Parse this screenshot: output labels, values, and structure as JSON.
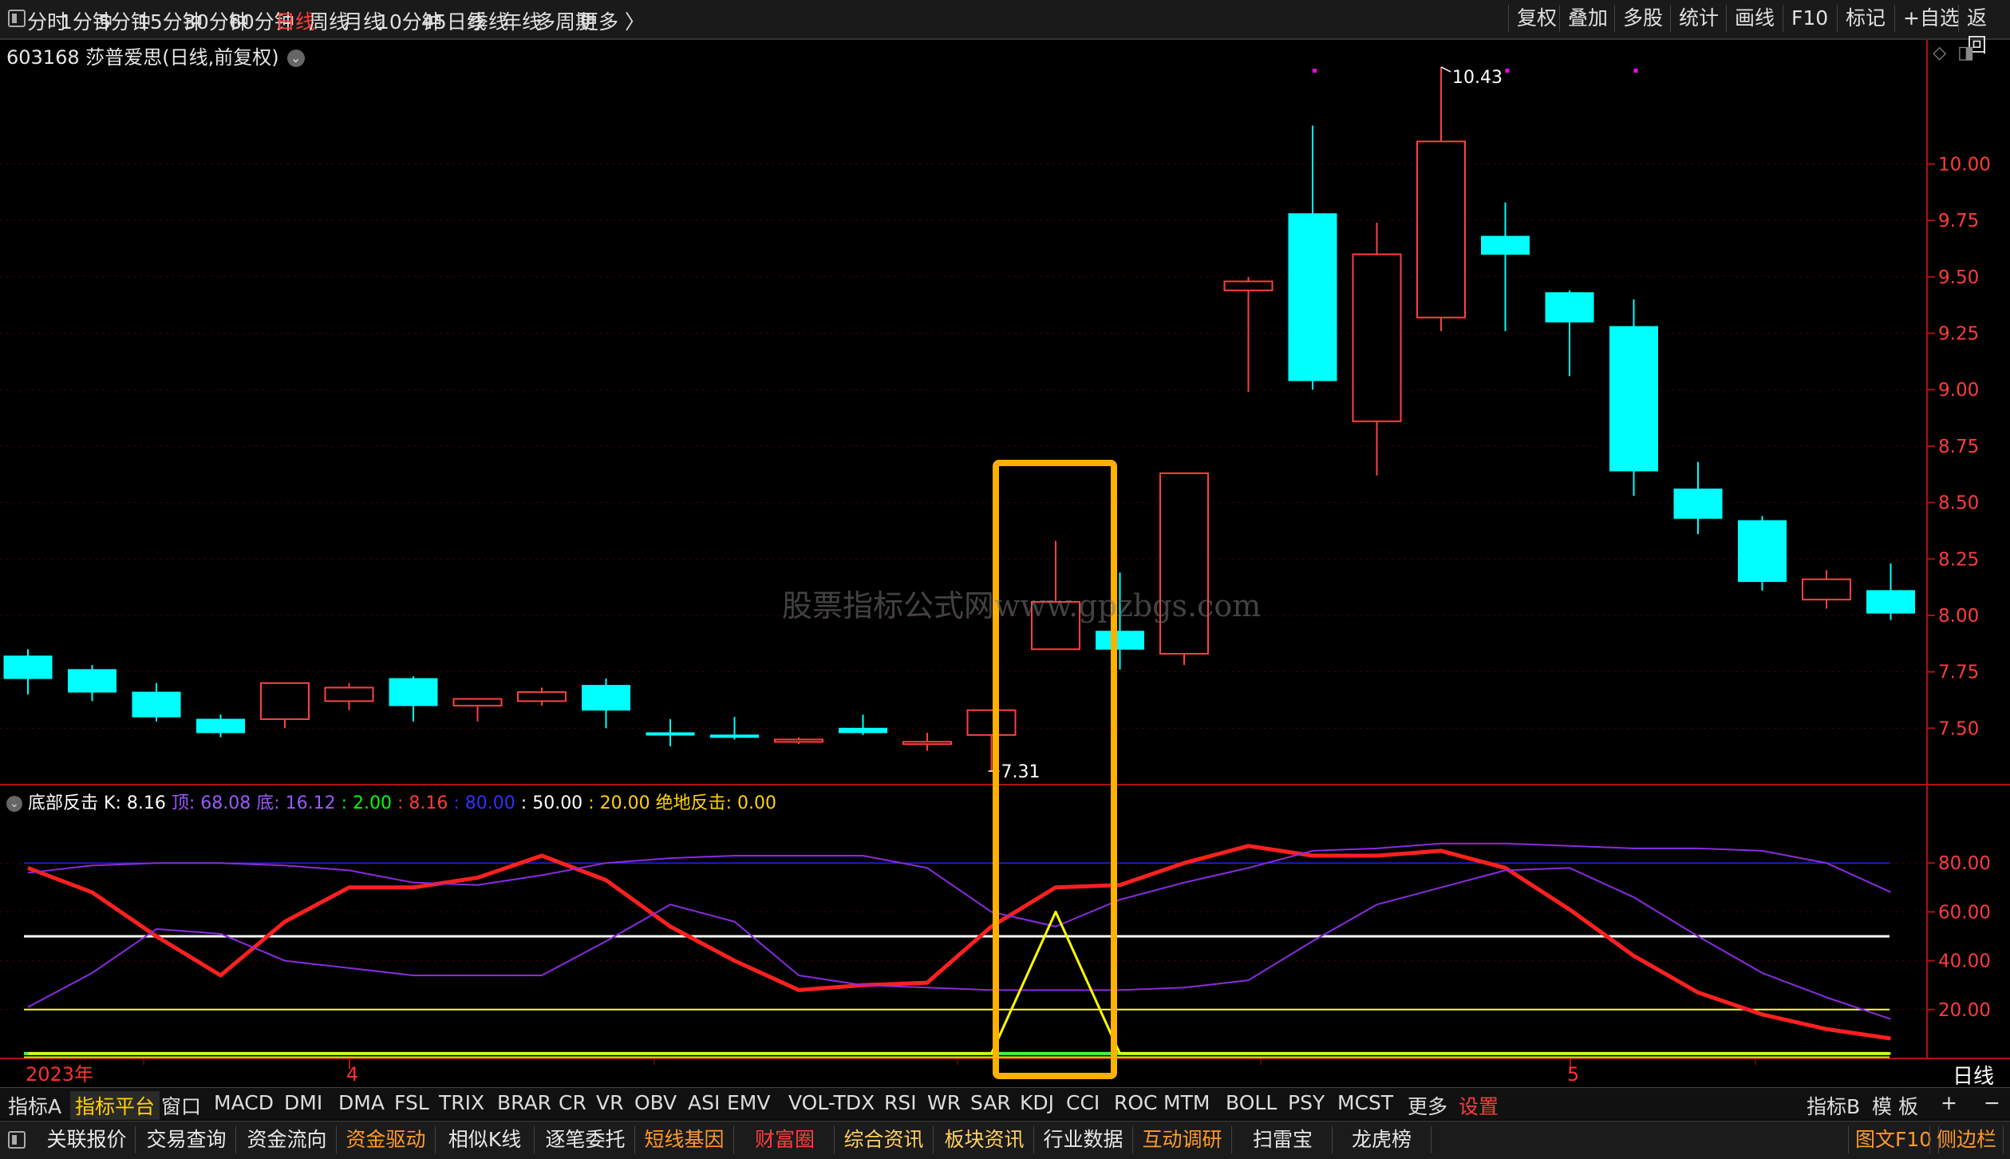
{
  "toolbar": {
    "periods": [
      "分时",
      "1分钟",
      "5分钟",
      "15分钟",
      "30分钟",
      "60分钟",
      "日线",
      "周线",
      "月线",
      "10分钟",
      "45日线",
      "季线",
      "年线",
      "多周期",
      "更多 〉"
    ],
    "active_period": "日线",
    "right_items": [
      "复权",
      "叠加",
      "多股",
      "统计",
      "画线",
      "F10",
      "标记",
      "+自选",
      "返回"
    ]
  },
  "stock": {
    "title": "603168 莎普爱思(日线,前复权)",
    "period_label": "日线",
    "high_label": "10.43",
    "low_label": "7.31"
  },
  "watermark": "股票指标公式网www.gpzbgs.com",
  "indicator": {
    "name": "底部反击",
    "k": "K: 8.16",
    "top": "顶: 68.08",
    "bottom": "底: 16.12",
    "v1": ": 2.00",
    "v2": ": 8.16",
    "v3": ": 80.00",
    "v4": ": 50.00",
    "v5": ": 20.00",
    "v6": "绝地反击: 0.00",
    "colors": {
      "k": "#ffffff",
      "top": "#9b59ff",
      "bottom": "#9b59ff",
      "v1": "#00ff00",
      "v2": "#ff3c3c",
      "v3": "#2020ff",
      "v4": "#ffffff",
      "v5": "#ffd400",
      "v6": "#ffd400"
    }
  },
  "date_axis": {
    "year": "2023年",
    "m4": "4",
    "m5": "5"
  },
  "indicator_tabs": [
    "指标A",
    "指标平台",
    "窗口",
    "MACD",
    "DMI",
    "DMA",
    "FSL",
    "TRIX",
    "BRAR",
    "CR",
    "VR",
    "OBV",
    "ASI",
    "EMV",
    "VOL-TDX",
    "RSI",
    "WR",
    "SAR",
    "KDJ",
    "CCI",
    "ROC",
    "MTM",
    "BOLL",
    "PSY",
    "MCST",
    "更多",
    "设置"
  ],
  "indicator_right": [
    "指标B",
    "模 板",
    "+",
    "−"
  ],
  "bottom_tabs": [
    "关联报价",
    "交易查询",
    "资金流向",
    "资金驱动",
    "相似K线",
    "逐笔委托",
    "短线基因",
    "财富圈",
    "综合资讯",
    "板块资讯",
    "行业数据",
    "互动调研",
    "扫雷宝",
    "龙虎榜"
  ],
  "bottom_right": [
    "图文F10",
    "侧边栏"
  ],
  "chart_data": [
    {
      "type": "candlestick",
      "price_axis": [
        10.0,
        9.75,
        9.5,
        9.25,
        9.0,
        8.75,
        8.5,
        8.25,
        8.0,
        7.75,
        7.5
      ],
      "ylim": [
        7.25,
        10.55
      ],
      "candles": [
        {
          "o": 7.82,
          "h": 7.85,
          "l": 7.65,
          "c": 7.72,
          "up": false
        },
        {
          "o": 7.76,
          "h": 7.78,
          "l": 7.62,
          "c": 7.66,
          "up": false
        },
        {
          "o": 7.66,
          "h": 7.7,
          "l": 7.53,
          "c": 7.55,
          "up": false
        },
        {
          "o": 7.54,
          "h": 7.56,
          "l": 7.46,
          "c": 7.48,
          "up": false
        },
        {
          "o": 7.54,
          "h": 7.7,
          "l": 7.5,
          "c": 7.7,
          "up": true
        },
        {
          "o": 7.62,
          "h": 7.7,
          "l": 7.58,
          "c": 7.68,
          "up": true
        },
        {
          "o": 7.72,
          "h": 7.73,
          "l": 7.53,
          "c": 7.6,
          "up": false
        },
        {
          "o": 7.6,
          "h": 7.63,
          "l": 7.53,
          "c": 7.63,
          "up": true
        },
        {
          "o": 7.62,
          "h": 7.68,
          "l": 7.6,
          "c": 7.66,
          "up": true
        },
        {
          "o": 7.69,
          "h": 7.72,
          "l": 7.5,
          "c": 7.58,
          "up": false
        },
        {
          "o": 7.48,
          "h": 7.54,
          "l": 7.42,
          "c": 7.47,
          "up": false
        },
        {
          "o": 7.47,
          "h": 7.55,
          "l": 7.45,
          "c": 7.46,
          "up": false
        },
        {
          "o": 7.44,
          "h": 7.46,
          "l": 7.43,
          "c": 7.45,
          "up": true
        },
        {
          "o": 7.5,
          "h": 7.56,
          "l": 7.47,
          "c": 7.48,
          "up": false
        },
        {
          "o": 7.43,
          "h": 7.48,
          "l": 7.4,
          "c": 7.44,
          "up": true
        },
        {
          "o": 7.47,
          "h": 7.51,
          "l": 7.31,
          "c": 7.58,
          "up": true
        },
        {
          "o": 7.85,
          "h": 8.33,
          "l": 7.85,
          "c": 8.06,
          "up": true
        },
        {
          "o": 7.93,
          "h": 8.19,
          "l": 7.76,
          "c": 7.85,
          "up": false
        },
        {
          "o": 7.83,
          "h": 8.63,
          "l": 7.78,
          "c": 8.63,
          "up": true
        },
        {
          "o": 9.44,
          "h": 9.5,
          "l": 8.99,
          "c": 9.48,
          "up": true
        },
        {
          "o": 9.78,
          "h": 10.17,
          "l": 9.0,
          "c": 9.04,
          "up": false
        },
        {
          "o": 8.86,
          "h": 9.74,
          "l": 8.62,
          "c": 9.6,
          "up": true
        },
        {
          "o": 9.32,
          "h": 10.43,
          "l": 9.26,
          "c": 10.1,
          "up": true
        },
        {
          "o": 9.68,
          "h": 9.83,
          "l": 9.26,
          "c": 9.6,
          "up": false
        },
        {
          "o": 9.43,
          "h": 9.44,
          "l": 9.06,
          "c": 9.3,
          "up": false
        },
        {
          "o": 9.28,
          "h": 9.4,
          "l": 8.53,
          "c": 8.64,
          "up": false
        },
        {
          "o": 8.56,
          "h": 8.68,
          "l": 8.36,
          "c": 8.43,
          "up": false
        },
        {
          "o": 8.42,
          "h": 8.44,
          "l": 8.11,
          "c": 8.15,
          "up": false
        },
        {
          "o": 8.07,
          "h": 8.2,
          "l": 8.03,
          "c": 8.16,
          "up": true
        },
        {
          "o": 8.11,
          "h": 8.23,
          "l": 7.98,
          "c": 8.01,
          "up": false
        }
      ]
    },
    {
      "type": "line",
      "title": "底部反击",
      "ylim": [
        0,
        100
      ],
      "y_ticks": [
        80.0,
        60.0,
        40.0,
        20.0
      ],
      "reference_lines": [
        80,
        50,
        20,
        2
      ],
      "series": [
        {
          "name": "K",
          "color": "#ff2020",
          "values": [
            78,
            68,
            50,
            34,
            56,
            70,
            70,
            74,
            83,
            73,
            54,
            40,
            28,
            30,
            31,
            54,
            70,
            71,
            80,
            87,
            83,
            83,
            85,
            78,
            61,
            42,
            27,
            18,
            12,
            8.16
          ]
        },
        {
          "name": "顶",
          "color": "#8a2be2",
          "values": [
            76,
            79,
            80,
            80,
            79,
            77,
            72,
            71,
            75,
            80,
            82,
            83,
            83,
            83,
            78,
            60,
            54,
            65,
            72,
            78,
            85,
            86,
            88,
            88,
            87,
            86,
            86,
            85,
            80,
            68.08
          ]
        },
        {
          "name": "底",
          "color": "#8a2be2",
          "values": [
            21,
            35,
            53,
            51,
            40,
            37,
            34,
            34,
            34,
            48,
            63,
            56,
            34,
            30,
            29,
            28,
            28,
            28,
            29,
            32,
            48,
            63,
            70,
            77,
            78,
            66,
            50,
            35,
            25,
            16.12
          ]
        },
        {
          "name": "",
          "color": "#ffff00",
          "values": [
            2,
            2,
            2,
            2,
            2,
            2,
            2,
            2,
            2,
            2,
            2,
            2,
            2,
            2,
            2,
            2,
            60,
            2,
            2,
            2,
            2,
            2,
            2,
            2,
            2,
            2,
            2,
            2,
            2,
            2
          ]
        }
      ]
    }
  ]
}
